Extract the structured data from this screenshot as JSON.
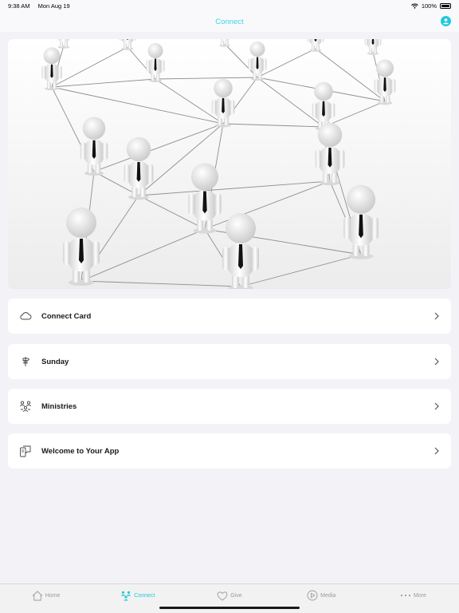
{
  "status": {
    "time": "9:38 AM",
    "date": "Mon Aug 19",
    "battery": "100%"
  },
  "nav": {
    "title": "Connect"
  },
  "hero": {
    "icon": "network-people-image"
  },
  "rows": [
    {
      "label": "Connect Card",
      "icon": "cloud-icon"
    },
    {
      "label": "Sunday",
      "icon": "signpost-icon"
    },
    {
      "label": "Ministries",
      "icon": "people-group-icon"
    },
    {
      "label": "Welcome to Your App",
      "icon": "devices-icon"
    }
  ],
  "tabs": [
    {
      "label": "Home",
      "icon": "home-icon",
      "active": false
    },
    {
      "label": "Connect",
      "icon": "people-icon",
      "active": true
    },
    {
      "label": "Give",
      "icon": "heart-icon",
      "active": false
    },
    {
      "label": "Media",
      "icon": "play-icon",
      "active": false
    },
    {
      "label": "More",
      "icon": "more-icon",
      "active": false
    }
  ],
  "colors": {
    "accent": "#22c7de",
    "background": "#f2f2f7"
  }
}
